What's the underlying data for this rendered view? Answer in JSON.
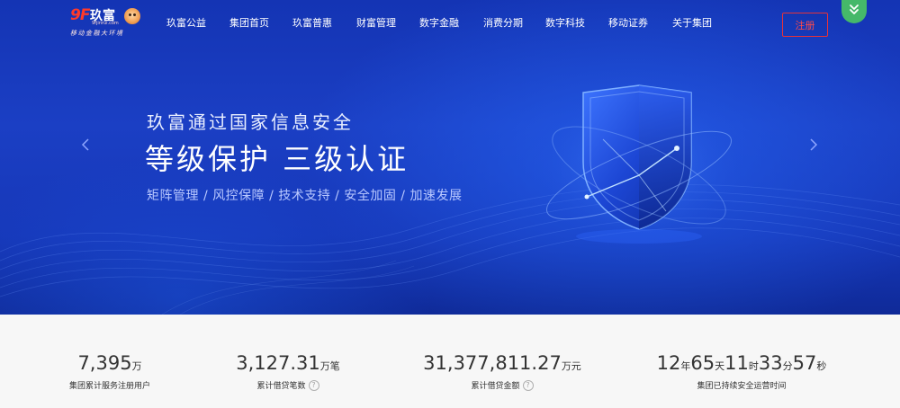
{
  "logo": {
    "mark": "9F",
    "name": "玖富",
    "domain": "9fjinrui.com",
    "slogan": "移动金融大环境",
    "mascot": "mascot-icon"
  },
  "nav": {
    "items": [
      {
        "label": "玖富公益"
      },
      {
        "label": "集团首页"
      },
      {
        "label": "玖富普惠"
      },
      {
        "label": "财富管理"
      },
      {
        "label": "数字金融"
      },
      {
        "label": "消费分期"
      },
      {
        "label": "数字科技"
      },
      {
        "label": "移动证券"
      },
      {
        "label": "关于集团"
      }
    ],
    "register_label": "注册",
    "scroll_icon": "double-chevron-down-icon"
  },
  "hero": {
    "subtitle": "玖富通过国家信息安全",
    "title": "等级保护  三级认证",
    "tags": "矩阵管理 / 风控保障 / 技术支持 / 安全加固 / 加速发展",
    "prev_icon": "chevron-left-icon",
    "next_icon": "chevron-right-icon",
    "graphic_icon": "shield-icon"
  },
  "stats": [
    {
      "value": "7,395",
      "unit": "万",
      "caption": "集团累计服务注册用户",
      "help": false
    },
    {
      "value": "3,127.31",
      "unit": "万笔",
      "caption": "累计借贷笔数",
      "help": true
    },
    {
      "value": "31,377,811.27",
      "unit": "万元",
      "caption": "累计借贷金额",
      "help": true
    },
    {
      "parts": [
        {
          "n": "12",
          "u": "年"
        },
        {
          "n": "65",
          "u": "天"
        },
        {
          "n": "11",
          "u": "时"
        },
        {
          "n": "33",
          "u": "分"
        },
        {
          "n": "57",
          "u": "秒"
        }
      ],
      "caption": "集团已持续安全运营时间",
      "help": false
    }
  ],
  "help_glyph": "?",
  "colors": {
    "hero_blue": "#1637b8",
    "register_red": "#e4323a",
    "scroll_green": "#45b86a",
    "stats_bg": "#f7f7f7"
  }
}
